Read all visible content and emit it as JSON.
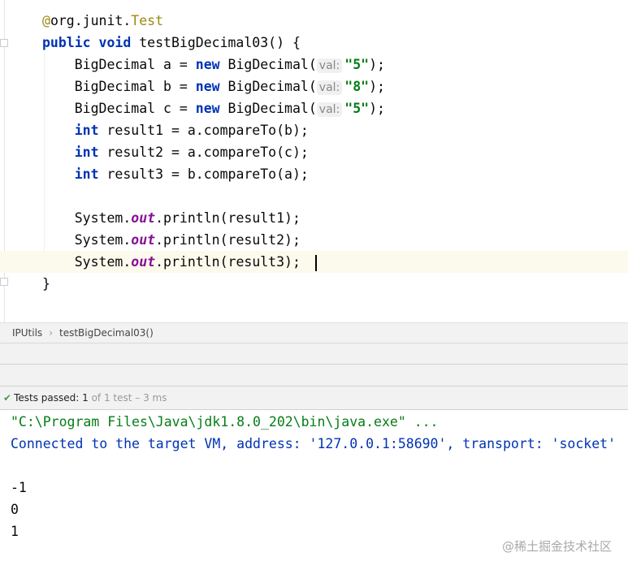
{
  "editor": {
    "annotation_at": "@",
    "annotation_pkg": "org.junit.",
    "annotation_name": "Test",
    "method_kw1": "public",
    "method_kw2": "void",
    "method_sig": " testBigDecimal03() {",
    "decls": [
      {
        "pre": "BigDecimal a = ",
        "kw": "new",
        "post": " BigDecimal(",
        "hint": "val:",
        "str": "\"5\"",
        "end": ");"
      },
      {
        "pre": "BigDecimal b = ",
        "kw": "new",
        "post": " BigDecimal(",
        "hint": "val:",
        "str": "\"8\"",
        "end": ");"
      },
      {
        "pre": "BigDecimal c = ",
        "kw": "new",
        "post": " BigDecimal(",
        "hint": "val:",
        "str": "\"5\"",
        "end": ");"
      }
    ],
    "ints": [
      {
        "kw": "int",
        "rest": " result1 = a.compareTo(b);"
      },
      {
        "kw": "int",
        "rest": " result2 = a.compareTo(c);"
      },
      {
        "kw": "int",
        "rest": " result3 = b.compareTo(a);"
      }
    ],
    "prints": [
      {
        "pre": "System.",
        "out": "out",
        "rest": ".println(result1);"
      },
      {
        "pre": "System.",
        "out": "out",
        "rest": ".println(result2);"
      },
      {
        "pre": "System.",
        "out": "out",
        "rest": ".println(result3);"
      }
    ],
    "close_brace": "}"
  },
  "breadcrumb": {
    "class": "IPUtils",
    "method": "testBigDecimal03()",
    "sep": "›"
  },
  "tests": {
    "label": "Tests passed:",
    "count": "1",
    "detail": "of 1 test – 3 ms"
  },
  "console": {
    "cmd": "\"C:\\Program Files\\Java\\jdk1.8.0_202\\bin\\java.exe\" ...",
    "connected": "Connected to the target VM, address: '127.0.0.1:58690', transport: 'socket'",
    "outputs": [
      "-1",
      "0",
      "1"
    ]
  },
  "watermark": "@稀土掘金技术社区"
}
